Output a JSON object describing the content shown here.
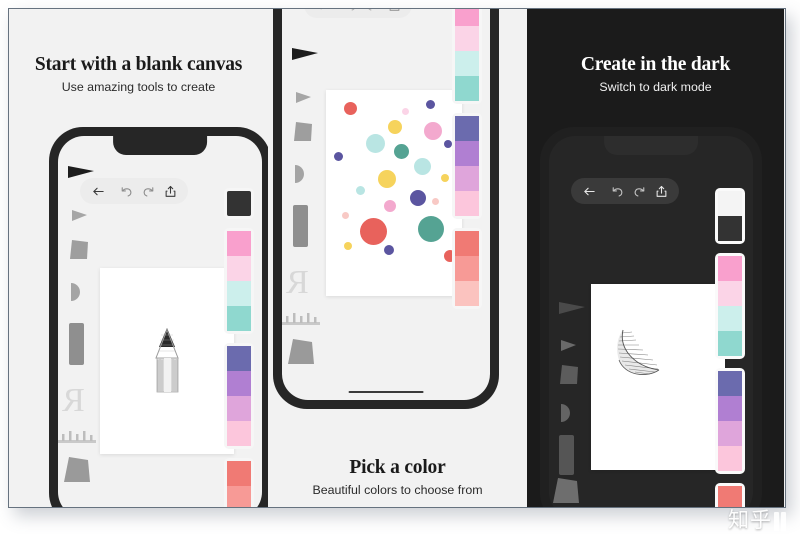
{
  "frame": {
    "border_color": "#66727f",
    "background": "#f2f2f2"
  },
  "panels": [
    {
      "id": "panel-1",
      "theme": "light",
      "title": "Start with a blank canvas",
      "subtitle": "Use amazing tools to create",
      "caption_position": "top",
      "background": "#f2f2f2",
      "artwork": "pencil-sketch",
      "toolbar": {
        "back_label": "Back",
        "undo_label": "Undo",
        "redo_label": "Redo",
        "share_label": "Share"
      }
    },
    {
      "id": "panel-2",
      "theme": "light",
      "title": "Pick a color",
      "subtitle": "Beautiful colors to choose from",
      "caption_position": "bottom",
      "background": "#f2f2f2",
      "artwork": "confetti-dots",
      "toolbar": {
        "back_label": "Back",
        "undo_label": "Undo",
        "redo_label": "Redo",
        "share_label": "Share"
      }
    },
    {
      "id": "panel-3",
      "theme": "dark",
      "title": "Create in the dark",
      "subtitle": "Switch to dark mode",
      "caption_position": "top",
      "background": "#1b1b1b",
      "artwork": "moon-sketch",
      "toolbar": {
        "back_label": "Back",
        "undo_label": "Undo",
        "redo_label": "Redo",
        "share_label": "Share"
      }
    }
  ],
  "palette": {
    "light_selected": "#333333",
    "dark_selected_top": "#f4f4f4",
    "dark_selected_bottom": "#333333",
    "groups": [
      {
        "name": "pinks-mints",
        "colors": [
          "#f9a0cd",
          "#fbd4e7",
          "#ccefec",
          "#8fd8cf"
        ]
      },
      {
        "name": "purples",
        "colors": [
          "#6b6bae",
          "#b07fd2",
          "#dfa5db",
          "#fcc6dc"
        ]
      },
      {
        "name": "reds",
        "colors": [
          "#f07a74",
          "#f79a96",
          "#fbc3bf"
        ]
      }
    ]
  },
  "confetti": {
    "colors": [
      "#e8625c",
      "#f6d35c",
      "#f3a9ce",
      "#b9e5e3",
      "#55a393",
      "#5b55a0",
      "#f8c9c5",
      "#6fc7bd"
    ],
    "count": 22
  },
  "tool_rail": {
    "items": [
      "triangle-tool",
      "trapezoid-tool",
      "half-circle-tool",
      "rectangle-tool",
      "letter-r-tool",
      "ruler-tool",
      "quad-tool"
    ],
    "color": "#9b9b9b"
  },
  "watermark": {
    "text": "知乎",
    "bars": 2
  }
}
